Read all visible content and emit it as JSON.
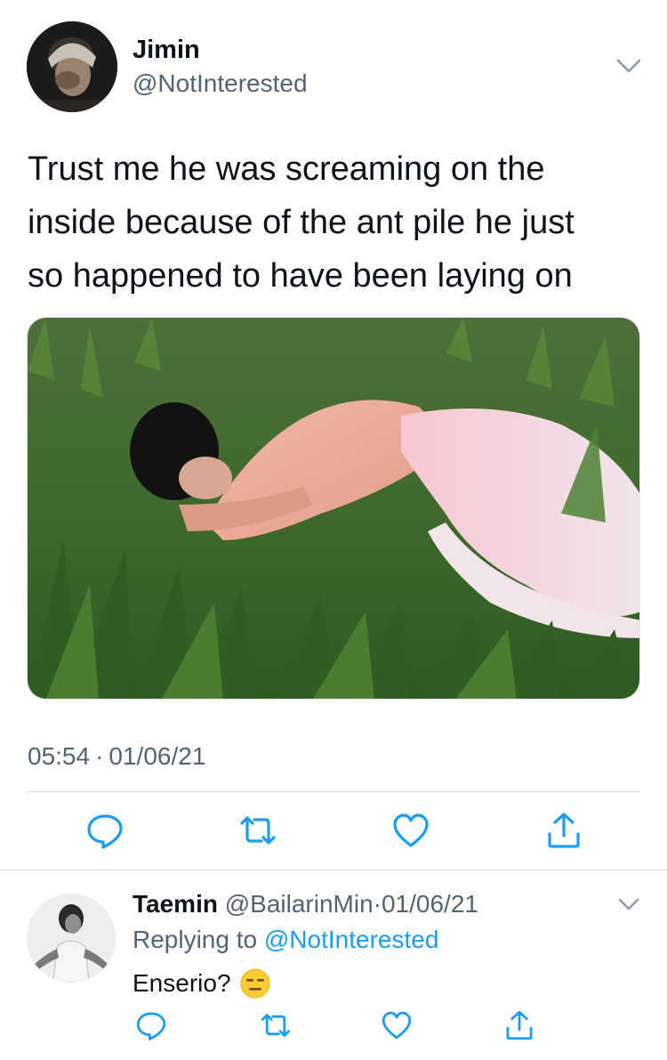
{
  "tweet": {
    "author": {
      "name": "Jimin",
      "handle": "@NotInterested",
      "avatar_icon": "profile-photo-icon"
    },
    "lines": [
      "Trust me he was screaming on the",
      "inside because of the ant pile he just",
      "so happened to have been laying on"
    ],
    "media_icon": "photo-person-lying-in-grass",
    "time": "05:54",
    "dot": "·",
    "date": "01/06/21",
    "actions": [
      "reply-icon",
      "retweet-icon",
      "like-icon",
      "share-icon"
    ]
  },
  "reply": {
    "author": {
      "name": "Taemin",
      "handle": "@BailarinMin",
      "dot": "·",
      "date": "01/06/21"
    },
    "replying_prefix": "Replying to",
    "replying_mention": "@NotInterested",
    "text": "Enserio?",
    "emoji": "expressionless-face-emoji",
    "actions": [
      "reply-icon",
      "retweet-icon",
      "like-icon",
      "share-icon"
    ]
  },
  "colors": {
    "text": "#0f1419",
    "secondary": "#536471",
    "accent": "#1d9bf0",
    "divider": "#d6dbe0"
  }
}
